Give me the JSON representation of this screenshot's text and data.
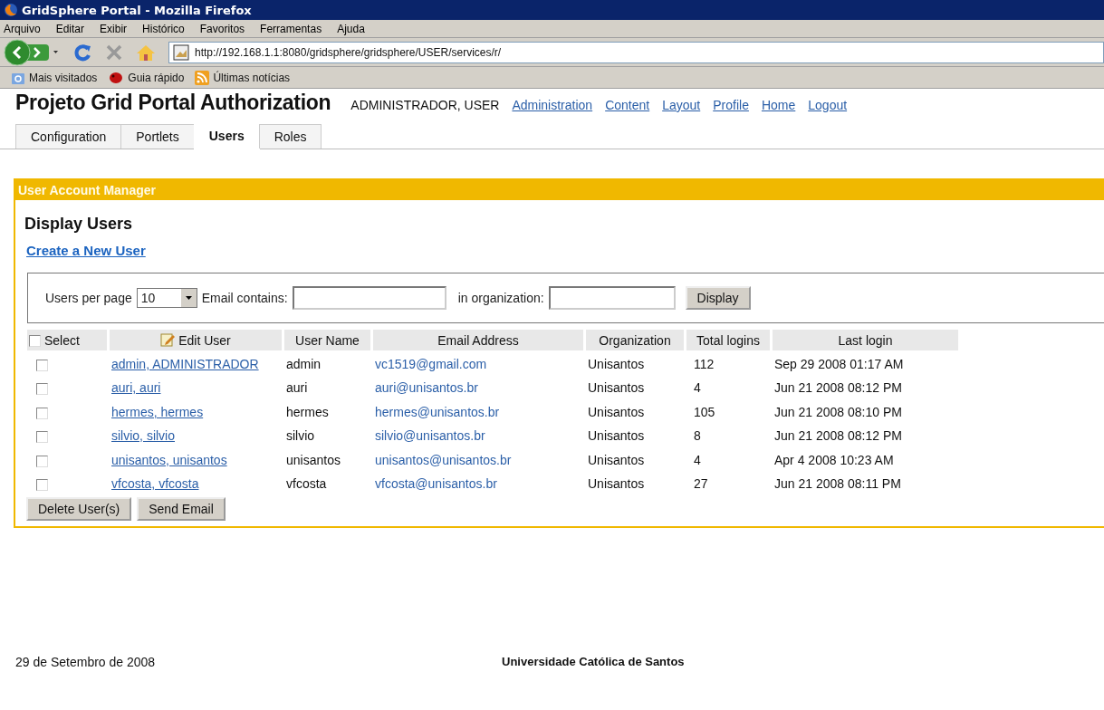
{
  "window": {
    "title": "GridSphere Portal - Mozilla Firefox"
  },
  "menu": [
    "Arquivo",
    "Editar",
    "Exibir",
    "Histórico",
    "Favoritos",
    "Ferramentas",
    "Ajuda"
  ],
  "address_bar": {
    "value": "http://192.168.1.1:8080/gridsphere/gridsphere/USER/services/r/"
  },
  "bookmarks": [
    {
      "kind": "search",
      "label": "Mais visitados"
    },
    {
      "kind": "bug",
      "label": "Guia rápido"
    },
    {
      "kind": "feed",
      "label": "Últimas notícias"
    }
  ],
  "portal": {
    "title": "Projeto Grid Portal Authorization",
    "user": "ADMINISTRADOR, USER",
    "links": [
      "Administration",
      "Content",
      "Layout",
      "Profile",
      "Home",
      "Logout"
    ]
  },
  "tabs": [
    {
      "label": "Configuration",
      "selected": false
    },
    {
      "label": "Portlets",
      "selected": false
    },
    {
      "label": "Users",
      "selected": true
    },
    {
      "label": "Roles",
      "selected": false
    }
  ],
  "portlet": {
    "title": "User Account Manager",
    "heading": "Display Users",
    "create_link": "Create a New User",
    "filter": {
      "per_page_label": "Users per page",
      "per_page_value": "10",
      "email_label": "Email contains:",
      "org_label": "in organization:",
      "display_button": "Display"
    },
    "table": {
      "select_all": {
        "label": "Select",
        "checked": false
      },
      "columns": [
        "Edit User",
        "User Name",
        "Email Address",
        "Organization",
        "Total logins",
        "Last login"
      ],
      "rows": [
        {
          "checked": false,
          "edit": "admin, ADMINISTRADOR",
          "user_name": "admin",
          "email": "vc1519@gmail.com",
          "organization": "Unisantos",
          "total_logins": "112",
          "last_login": "Sep 29 2008 01:17 AM"
        },
        {
          "checked": false,
          "edit": "auri, auri",
          "user_name": "auri",
          "email": "auri@unisantos.br",
          "organization": "Unisantos",
          "total_logins": "4",
          "last_login": "Jun 21 2008 08:12 PM"
        },
        {
          "checked": false,
          "edit": "hermes, hermes",
          "user_name": "hermes",
          "email": "hermes@unisantos.br",
          "organization": "Unisantos",
          "total_logins": "105",
          "last_login": "Jun 21 2008 08:10 PM"
        },
        {
          "checked": false,
          "edit": "silvio, silvio",
          "user_name": "silvio",
          "email": "silvio@unisantos.br",
          "organization": "Unisantos",
          "total_logins": "8",
          "last_login": "Jun 21 2008 08:12 PM"
        },
        {
          "checked": false,
          "edit": "unisantos, unisantos",
          "user_name": "unisantos",
          "email": "unisantos@unisantos.br",
          "organization": "Unisantos",
          "total_logins": "4",
          "last_login": "Apr 4 2008 10:23 AM"
        },
        {
          "checked": false,
          "edit": "vfcosta, vfcosta",
          "user_name": "vfcosta",
          "email": "vfcosta@unisantos.br",
          "organization": "Unisantos",
          "total_logins": "27",
          "last_login": "Jun 21 2008 08:11 PM"
        }
      ]
    },
    "buttons": [
      "Delete User(s)",
      "Send Email"
    ]
  },
  "footer": {
    "date": "29 de Setembro de 2008",
    "institution": "Universidade Católica de Santos"
  }
}
